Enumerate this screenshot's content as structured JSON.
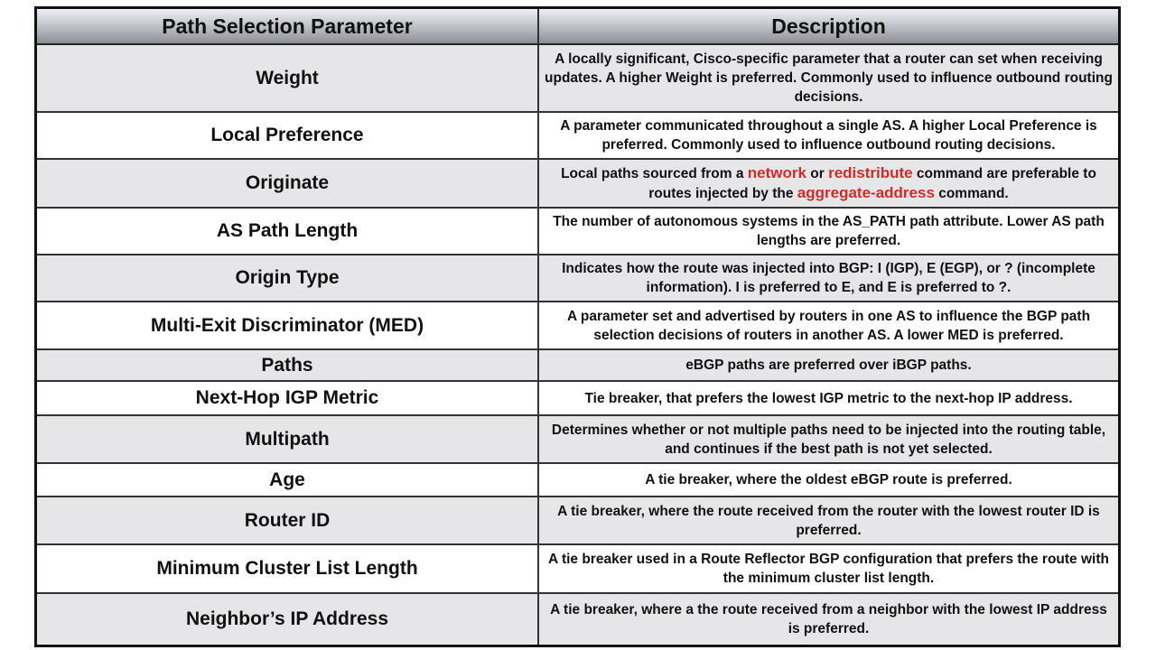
{
  "header": {
    "param": "Path Selection Parameter",
    "description": "Description"
  },
  "rows": [
    {
      "param": "Weight",
      "description": "A locally significant, Cisco-specific parameter that a router can set when receiving updates. A higher Weight is preferred. Commonly used to influence outbound routing decisions."
    },
    {
      "param": "Local Preference",
      "description": "A parameter communicated throughout a single AS. A higher Local Preference is preferred. Commonly used to influence outbound routing decisions."
    },
    {
      "param": "Originate",
      "description_parts": [
        "Local paths sourced from a ",
        "network",
        " or ",
        "redistribute",
        " command are preferable to routes injected by the ",
        "aggregate-address",
        " command."
      ]
    },
    {
      "param": "AS Path Length",
      "description": "The number of autonomous systems in the AS_PATH path attribute. Lower AS path lengths are preferred."
    },
    {
      "param": "Origin Type",
      "description": "Indicates how the route was injected into BGP: I (IGP), E (EGP), or ? (incomplete information). I is preferred to E, and E is preferred to ?."
    },
    {
      "param": "Multi-Exit Discriminator (MED)",
      "description": "A parameter set and advertised by routers in one AS to influence the BGP path selection decisions of routers in another AS. A lower MED is preferred."
    },
    {
      "param": "Paths",
      "description": "eBGP paths are preferred over iBGP paths."
    },
    {
      "param": "Next-Hop IGP Metric",
      "description": "Tie breaker, that prefers the lowest IGP metric to the next-hop IP address."
    },
    {
      "param": "Multipath",
      "description": "Determines whether or not multiple paths need to be injected into the routing table, and continues if the best path is not yet selected."
    },
    {
      "param": "Age",
      "description": "A tie breaker, where the oldest eBGP route is preferred."
    },
    {
      "param": "Router ID",
      "description": "A tie breaker, where the route received from the router with the lowest router ID is preferred."
    },
    {
      "param": "Minimum Cluster List Length",
      "description": "A tie breaker used in a Route Reflector BGP configuration that prefers the route with the minimum cluster list length."
    },
    {
      "param": "Neighbor’s IP Address",
      "description": "A tie breaker, where a the route received from a neighbor with the lowest IP address is preferred."
    }
  ],
  "colors": {
    "keyword": "#d42a26",
    "row_gray": "#e6e6e8",
    "row_white": "#ffffff"
  }
}
